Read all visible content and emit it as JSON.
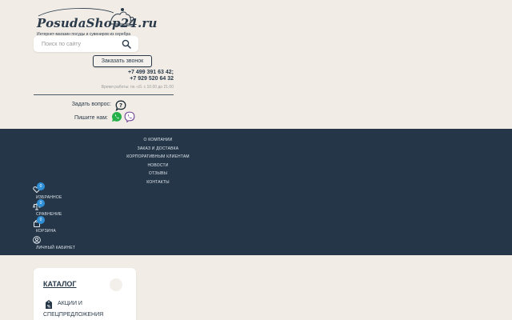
{
  "header": {
    "logo_text": "PosudaShop24.ru",
    "logo_tagline": "Интернет-магазин посуды и сувениров из серебра",
    "search_placeholder": "Поиск по сайту",
    "callback_button": "Заказать звонок",
    "phones": [
      "+7 499 391 63 42;",
      "+7 929 520 64 32"
    ],
    "hours": "Время работы: пн.-сб. с 10.00 до 21.00",
    "ask_label": "Задать вопрос:",
    "write_label": "Пишите нам:"
  },
  "nav": {
    "items": [
      {
        "label": "О компании"
      },
      {
        "label": "Заказ и доставка"
      },
      {
        "label": "Корпоративным клиентам"
      },
      {
        "label": "Новости"
      },
      {
        "label": "Отзывы"
      },
      {
        "label": "Контакты"
      }
    ]
  },
  "user_links": {
    "favorites": {
      "label": "Избранное",
      "count": "0",
      "icon": "heart-icon"
    },
    "compare": {
      "label": "Сравнение",
      "count": "0",
      "icon": "scales-icon"
    },
    "cart": {
      "label": "Корзина",
      "count": "0",
      "icon": "bag-icon"
    },
    "account": {
      "label": "Личный кабинет",
      "icon": "user-icon"
    }
  },
  "catalog": {
    "title": "Каталог",
    "items": [
      {
        "label": "Акции и спецпредложения",
        "icon": "percent-tag-icon"
      }
    ]
  },
  "colors": {
    "navy": "#243648",
    "background": "#f1ede6",
    "badge_blue": "#2f8fd6",
    "whatsapp_green": "#25b14a",
    "viber_purple": "#7b519d"
  }
}
